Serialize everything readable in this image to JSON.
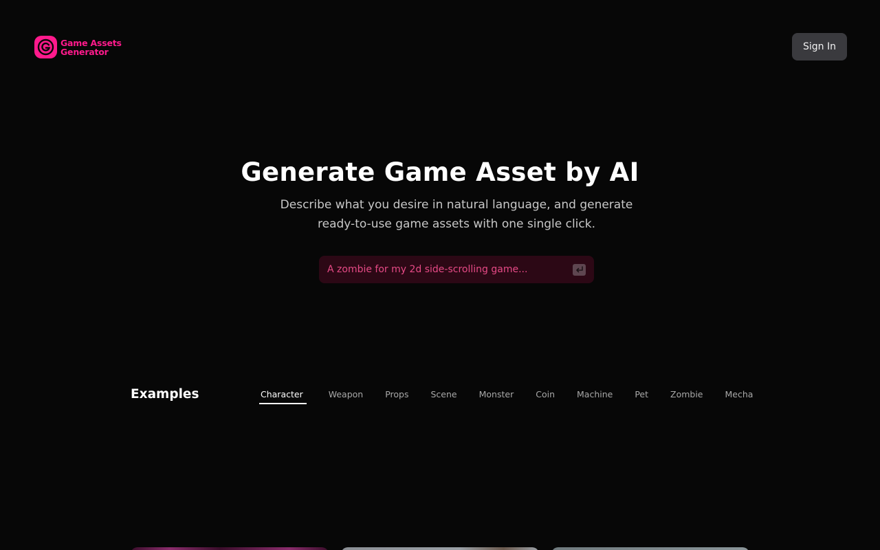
{
  "header": {
    "logo_line1": "Game Assets",
    "logo_line2": "Generator",
    "logo_icon": "logo-g-icon",
    "sign_in_label": "Sign In"
  },
  "hero": {
    "title": "Generate Game Asset by AI",
    "subtitle_line1": "Describe what you desire in natural language, and generate",
    "subtitle_line2": "ready-to-use game assets with one single click.",
    "prompt_placeholder": "A zombie for my 2d side-scrolling game...",
    "prompt_value": "",
    "submit_icon": "enter-key-icon"
  },
  "examples": {
    "title": "Examples",
    "tabs": [
      {
        "label": "Character",
        "active": true
      },
      {
        "label": "Weapon",
        "active": false
      },
      {
        "label": "Props",
        "active": false
      },
      {
        "label": "Scene",
        "active": false
      },
      {
        "label": "Monster",
        "active": false
      },
      {
        "label": "Coin",
        "active": false
      },
      {
        "label": "Machine",
        "active": false
      },
      {
        "label": "Pet",
        "active": false
      },
      {
        "label": "Zombie",
        "active": false
      },
      {
        "label": "Mecha",
        "active": false
      }
    ]
  },
  "colors": {
    "background": "#070707",
    "brand_pink": "#ff1a8c",
    "button_bg": "#3a3a3e",
    "prompt_bg": "#2c0815"
  }
}
